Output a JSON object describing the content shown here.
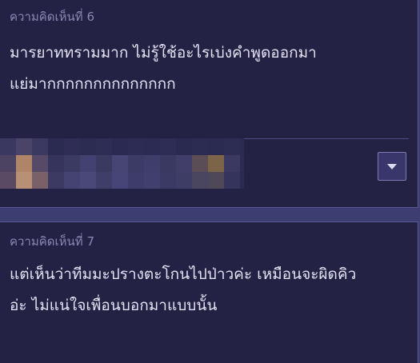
{
  "comments": [
    {
      "number_label": "ความคิดเห็นที่ 6",
      "body_lines": [
        "มารยาททรามมาก ไม่รู้ใช้อะไรเบ่งคำพูดออกมา",
        "แย่มากกกกกกกกกกกกกก"
      ],
      "author_avatar": "pixelated-censored-profile",
      "menu_icon": "chevron-down-icon"
    },
    {
      "number_label": "ความคิดเห็นที่ 7",
      "body_lines": [
        "แต่เห็นว่าทีมมะปรางตะโกนไปป่าวค่ะ  เหมือนจะผิดคิว",
        "อ่ะ ไม่แน่ใจเพื่อนบอกมาแบบนั้น"
      ]
    }
  ],
  "colors": {
    "page_background": "#3e3d72",
    "card_background": "#232144",
    "card_border": "#5a5894",
    "meta_text": "#8a88b4",
    "body_text": "#e4e3f2"
  }
}
